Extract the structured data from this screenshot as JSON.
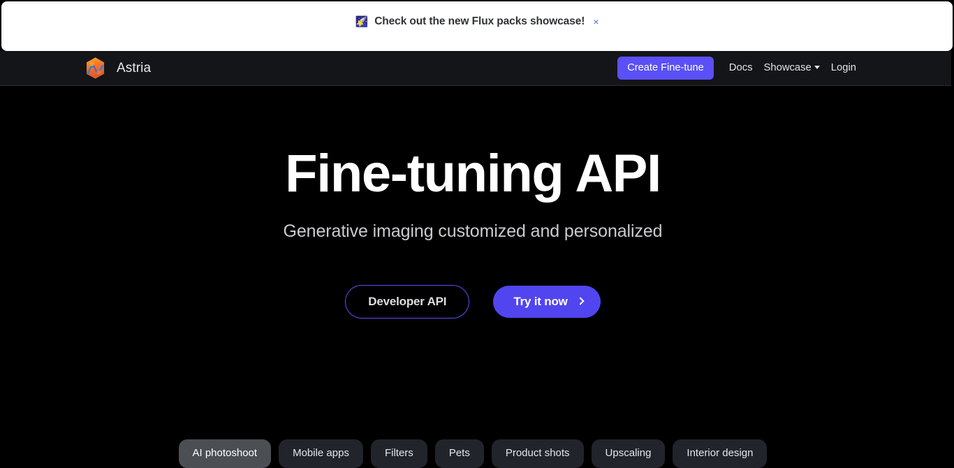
{
  "banner": {
    "icon": "shooting-star-emoji",
    "emoji": "🌠",
    "text": "Check out the new Flux packs showcase!",
    "close_label": "×"
  },
  "navbar": {
    "logo_icon": "astria-hexagon-logo",
    "brand": "Astria",
    "primary_button": "Create Fine-tune",
    "links": [
      {
        "label": "Docs",
        "has_caret": false
      },
      {
        "label": "Showcase",
        "has_caret": true
      },
      {
        "label": "Login",
        "has_caret": false
      }
    ]
  },
  "hero": {
    "title": "Fine-tuning API",
    "subtitle": "Generative imaging customized and personalized",
    "secondary_cta": "Developer API",
    "primary_cta": "Try it now",
    "primary_cta_icon": "chevron-right-icon"
  },
  "chips": [
    {
      "label": "AI photoshoot",
      "active": true
    },
    {
      "label": "Mobile apps",
      "active": false
    },
    {
      "label": "Filters",
      "active": false
    },
    {
      "label": "Pets",
      "active": false
    },
    {
      "label": "Product shots",
      "active": false
    },
    {
      "label": "Upscaling",
      "active": false
    },
    {
      "label": "Interior design",
      "active": false
    }
  ],
  "colors": {
    "accent_purple": "#5b50f5",
    "cta_purple": "#5145f0",
    "navbar_bg": "#141519",
    "page_bg": "#000000",
    "banner_bg": "#ffffff",
    "chip_bg": "#21242a",
    "chip_active_bg": "#4b4f54"
  }
}
